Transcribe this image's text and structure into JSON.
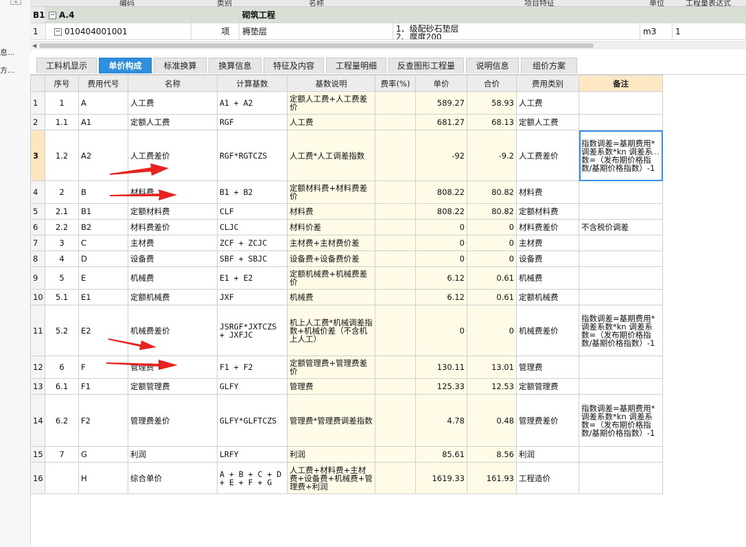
{
  "top_grid": {
    "header_fragments": [
      "编码",
      "类别",
      "名称",
      "项目特征",
      "单位",
      "工程量表达式"
    ],
    "rows": [
      {
        "idx": "B1",
        "tree": "−",
        "code": "A.4",
        "type": "",
        "name": "砌筑工程",
        "feature": "",
        "unit": "",
        "expr": ""
      },
      {
        "idx": "1",
        "tree": "−",
        "code": "010404001001",
        "type": "项",
        "name": "褥垫层",
        "feature_line1": "1、级配砂石垫层",
        "feature_line2": "2、厚度200",
        "unit": "m3",
        "expr": "1"
      }
    ]
  },
  "sidebar": {
    "text1": "息...",
    "text2": "方..."
  },
  "tabs": [
    {
      "label": "工料机显示",
      "active": false
    },
    {
      "label": "单价构成",
      "active": true
    },
    {
      "label": "标准换算",
      "active": false
    },
    {
      "label": "换算信息",
      "active": false
    },
    {
      "label": "特征及内容",
      "active": false
    },
    {
      "label": "工程量明细",
      "active": false
    },
    {
      "label": "反查图形工程量",
      "active": false
    },
    {
      "label": "说明信息",
      "active": false
    },
    {
      "label": "组价方案",
      "active": false
    }
  ],
  "table": {
    "columns": [
      "",
      "序号",
      "费用代号",
      "名称",
      "计算基数",
      "基数说明",
      "费率(%)",
      "单价",
      "合价",
      "费用类别",
      "备注"
    ],
    "rows": [
      {
        "idx": "1",
        "seq": "1",
        "code": "A",
        "name": "人工费",
        "base": "A1 + A2",
        "desc": "定额人工费+人工费差价",
        "rate": "",
        "price": "589.27",
        "total": "58.93",
        "cat": "人工费",
        "remark": ""
      },
      {
        "idx": "2",
        "seq": "1.1",
        "code": "A1",
        "name": "定额人工费",
        "base": "RGF",
        "desc": "人工费",
        "rate": "",
        "price": "681.27",
        "total": "68.13",
        "cat": "定额人工费",
        "remark": ""
      },
      {
        "idx": "3",
        "seq": "1.2",
        "code": "A2",
        "name": "人工费差价",
        "base": "RGF*RGTCZS",
        "desc": "人工费*人工调差指数",
        "rate": "",
        "price": "-92",
        "total": "-9.2",
        "cat": "人工费差价",
        "remark": "指数调差=基期费用*调差系数*kn 调差系数=（发布期价格指数/基期价格指数）-1"
      },
      {
        "idx": "4",
        "seq": "2",
        "code": "B",
        "name": "材料费",
        "base": "B1 + B2",
        "desc": "定额材料费+材料费差价",
        "rate": "",
        "price": "808.22",
        "total": "80.82",
        "cat": "材料费",
        "remark": ""
      },
      {
        "idx": "5",
        "seq": "2.1",
        "code": "B1",
        "name": "定额材料费",
        "base": "CLF",
        "desc": "材料费",
        "rate": "",
        "price": "808.22",
        "total": "80.82",
        "cat": "定额材料费",
        "remark": ""
      },
      {
        "idx": "6",
        "seq": "2.2",
        "code": "B2",
        "name": "材料费差价",
        "base": "CLJC",
        "desc": "材料价差",
        "rate": "",
        "price": "0",
        "total": "0",
        "cat": "材料费差价",
        "remark": "不含税价调差"
      },
      {
        "idx": "7",
        "seq": "3",
        "code": "C",
        "name": "主材费",
        "base": "ZCF + ZCJC",
        "desc": "主材费+主材费价差",
        "rate": "",
        "price": "0",
        "total": "0",
        "cat": "主材费",
        "remark": ""
      },
      {
        "idx": "8",
        "seq": "4",
        "code": "D",
        "name": "设备费",
        "base": "SBF + SBJC",
        "desc": "设备费+设备费价差",
        "rate": "",
        "price": "0",
        "total": "0",
        "cat": "设备费",
        "remark": ""
      },
      {
        "idx": "9",
        "seq": "5",
        "code": "E",
        "name": "机械费",
        "base": "E1 + E2",
        "desc": "定额机械费+机械费差价",
        "rate": "",
        "price": "6.12",
        "total": "0.61",
        "cat": "机械费",
        "remark": ""
      },
      {
        "idx": "10",
        "seq": "5.1",
        "code": "E1",
        "name": "定额机械费",
        "base": "JXF",
        "desc": "机械费",
        "rate": "",
        "price": "6.12",
        "total": "0.61",
        "cat": "定额机械费",
        "remark": ""
      },
      {
        "idx": "11",
        "seq": "5.2",
        "code": "E2",
        "name": "机械费差价",
        "base": "JSRGF*JXTCZS + JXFJC",
        "desc": "机上人工费*机械调差指数+机械价差（不含机上人工）",
        "rate": "",
        "price": "0",
        "total": "0",
        "cat": "机械费差价",
        "remark": "指数调差=基期费用*调差系数*kn 调差系数=（发布期价格指数/基期价格指数）-1"
      },
      {
        "idx": "12",
        "seq": "6",
        "code": "F",
        "name": "管理费",
        "base": "F1 + F2",
        "desc": "定额管理费+管理费差价",
        "rate": "",
        "price": "130.11",
        "total": "13.01",
        "cat": "管理费",
        "remark": ""
      },
      {
        "idx": "13",
        "seq": "6.1",
        "code": "F1",
        "name": "定额管理费",
        "base": "GLFY",
        "desc": "管理费",
        "rate": "",
        "price": "125.33",
        "total": "12.53",
        "cat": "定额管理费",
        "remark": ""
      },
      {
        "idx": "14",
        "seq": "6.2",
        "code": "F2",
        "name": "管理费差价",
        "base": "GLFY*GLFTCZS",
        "desc": "管理费*管理费调差指数",
        "rate": "",
        "price": "4.78",
        "total": "0.48",
        "cat": "管理费差价",
        "remark": "指数调差=基期费用*调差系数*kn 调差系数=（发布期价格指数/基期价格指数）-1"
      },
      {
        "idx": "15",
        "seq": "7",
        "code": "G",
        "name": "利润",
        "base": "LRFY",
        "desc": "利润",
        "rate": "",
        "price": "85.61",
        "total": "8.56",
        "cat": "利润",
        "remark": ""
      },
      {
        "idx": "16",
        "seq": "",
        "code": "H",
        "name": "综合单价",
        "base": "A + B + C + D + E + F + G",
        "desc": "人工费+材料费+主材费+设备费+机械费+管理费+利润",
        "rate": "",
        "price": "1619.33",
        "total": "161.93",
        "cat": "工程造价",
        "remark": ""
      }
    ]
  },
  "colors": {
    "active_tab": "#2e8fe0",
    "selected_row": "#fce6bf",
    "remark_header": "#fde7c4",
    "base_desc_bg": "#fffbe7",
    "arrow": "#e8231f"
  }
}
